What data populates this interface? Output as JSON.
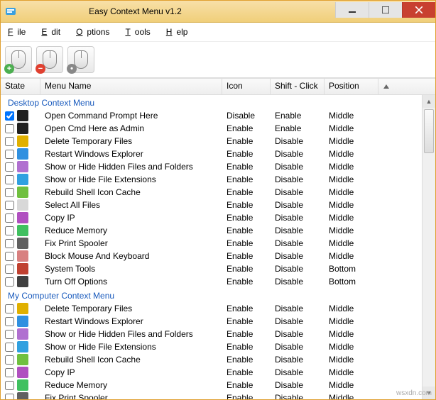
{
  "window": {
    "title": "Easy Context Menu v1.2"
  },
  "menubar": {
    "file": "File",
    "edit": "Edit",
    "options": "Options",
    "tools": "Tools",
    "help": "Help"
  },
  "headers": {
    "state": "State",
    "name": "Menu Name",
    "icon": "Icon",
    "shift": "Shift - Click",
    "pos": "Position"
  },
  "groups": [
    {
      "title": "Desktop Context Menu",
      "items": [
        {
          "chk": true,
          "color": "#202020",
          "name": "Open Command Prompt Here",
          "icon": "Disable",
          "shift": "Enable",
          "pos": "Middle"
        },
        {
          "chk": false,
          "color": "#202020",
          "name": "Open Cmd Here as Admin",
          "icon": "Enable",
          "shift": "Enable",
          "pos": "Middle"
        },
        {
          "chk": false,
          "color": "#e0b000",
          "name": "Delete Temporary Files",
          "icon": "Enable",
          "shift": "Disable",
          "pos": "Middle"
        },
        {
          "chk": false,
          "color": "#3090e0",
          "name": "Restart Windows Explorer",
          "icon": "Enable",
          "shift": "Disable",
          "pos": "Middle"
        },
        {
          "chk": false,
          "color": "#b070d0",
          "name": "Show or Hide Hidden Files and Folders",
          "icon": "Enable",
          "shift": "Disable",
          "pos": "Middle"
        },
        {
          "chk": false,
          "color": "#30a0e0",
          "name": "Show or Hide File Extensions",
          "icon": "Enable",
          "shift": "Disable",
          "pos": "Middle"
        },
        {
          "chk": false,
          "color": "#70c040",
          "name": "Rebuild Shell Icon Cache",
          "icon": "Enable",
          "shift": "Disable",
          "pos": "Middle"
        },
        {
          "chk": false,
          "color": "#d8d8d8",
          "name": "Select All Files",
          "icon": "Enable",
          "shift": "Disable",
          "pos": "Middle"
        },
        {
          "chk": false,
          "color": "#b050c0",
          "name": "Copy IP",
          "icon": "Enable",
          "shift": "Disable",
          "pos": "Middle"
        },
        {
          "chk": false,
          "color": "#40c060",
          "name": "Reduce Memory",
          "icon": "Enable",
          "shift": "Disable",
          "pos": "Middle"
        },
        {
          "chk": false,
          "color": "#606060",
          "name": "Fix Print Spooler",
          "icon": "Enable",
          "shift": "Disable",
          "pos": "Middle"
        },
        {
          "chk": false,
          "color": "#d88080",
          "name": "Block Mouse And Keyboard",
          "icon": "Enable",
          "shift": "Disable",
          "pos": "Middle"
        },
        {
          "chk": false,
          "color": "#c04030",
          "name": "System Tools",
          "icon": "Enable",
          "shift": "Disable",
          "pos": "Bottom"
        },
        {
          "chk": false,
          "color": "#404040",
          "name": "Turn Off Options",
          "icon": "Enable",
          "shift": "Disable",
          "pos": "Bottom"
        }
      ]
    },
    {
      "title": "My Computer Context Menu",
      "items": [
        {
          "chk": false,
          "color": "#e0b000",
          "name": "Delete Temporary Files",
          "icon": "Enable",
          "shift": "Disable",
          "pos": "Middle"
        },
        {
          "chk": false,
          "color": "#3090e0",
          "name": "Restart Windows Explorer",
          "icon": "Enable",
          "shift": "Disable",
          "pos": "Middle"
        },
        {
          "chk": false,
          "color": "#b070d0",
          "name": "Show or Hide Hidden Files and Folders",
          "icon": "Enable",
          "shift": "Disable",
          "pos": "Middle"
        },
        {
          "chk": false,
          "color": "#30a0e0",
          "name": "Show or Hide File Extensions",
          "icon": "Enable",
          "shift": "Disable",
          "pos": "Middle"
        },
        {
          "chk": false,
          "color": "#70c040",
          "name": "Rebuild Shell Icon Cache",
          "icon": "Enable",
          "shift": "Disable",
          "pos": "Middle"
        },
        {
          "chk": false,
          "color": "#b050c0",
          "name": "Copy IP",
          "icon": "Enable",
          "shift": "Disable",
          "pos": "Middle"
        },
        {
          "chk": false,
          "color": "#40c060",
          "name": "Reduce Memory",
          "icon": "Enable",
          "shift": "Disable",
          "pos": "Middle"
        },
        {
          "chk": false,
          "color": "#606060",
          "name": "Fix Print Spooler",
          "icon": "Enable",
          "shift": "Disable",
          "pos": "Middle"
        }
      ]
    }
  ],
  "watermark": "wsxdn.com"
}
